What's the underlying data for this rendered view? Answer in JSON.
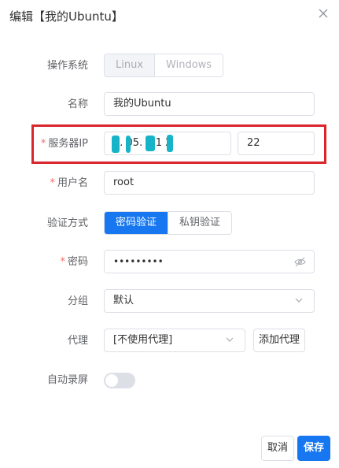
{
  "dialog": {
    "title": "编辑【我的Ubuntu】",
    "close_icon": "close-icon"
  },
  "os": {
    "label": "操作系统",
    "options": [
      "Linux",
      "Windows"
    ],
    "selected": "Linux"
  },
  "name": {
    "label": "名称",
    "value": "我的Ubuntu"
  },
  "server_ip": {
    "label": "服务器IP",
    "value": "0.  05.  7.1  2",
    "port": "22",
    "required": true
  },
  "username": {
    "label": "用户名",
    "value": "root",
    "required": true
  },
  "auth": {
    "label": "验证方式",
    "options": [
      "密码验证",
      "私钥验证"
    ],
    "selected": "密码验证"
  },
  "password": {
    "label": "密码",
    "value": "•••••••••",
    "required": true,
    "toggle_icon": "eye-off-icon"
  },
  "group": {
    "label": "分组",
    "value": "默认"
  },
  "proxy": {
    "label": "代理",
    "value": "[不使用代理]",
    "add_label": "添加代理"
  },
  "auto_record": {
    "label": "自动录屏",
    "enabled": false
  },
  "footer": {
    "cancel_label": "取消",
    "save_label": "保存"
  },
  "colors": {
    "primary": "#1677f0",
    "required": "#f56c6c",
    "highlight": "#d9262c"
  }
}
